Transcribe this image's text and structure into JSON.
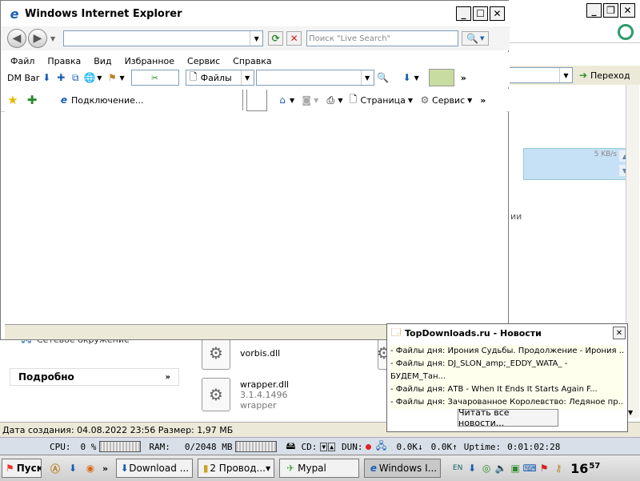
{
  "bg_window": {
    "addr_go_label": "Переход",
    "speed_text": "5 KB/s",
    "partial_text": "ии",
    "network_text": "Сетевое окружение",
    "details_label": "Подробно",
    "files": [
      {
        "name": "vorbis.dll",
        "version": "",
        "desc": ""
      },
      {
        "name": "wrapper.dll",
        "version": "3.1.4.1496",
        "desc": "wrapper"
      }
    ],
    "status_text": "Дата создания: 04.08.2022 23:56 Размер: 1,97 МБ"
  },
  "ie": {
    "title": "Windows Internet Explorer",
    "address_value": "",
    "search_placeholder": "Поиск \"Live Search\"",
    "menu": [
      "Файл",
      "Правка",
      "Вид",
      "Избранное",
      "Сервис",
      "Справка"
    ],
    "dmbar_label": "DM Bar",
    "files_combo": "Файлы",
    "fav_tab": "Подключение...",
    "page_label": "Страница",
    "service_label": "Сервис"
  },
  "popup": {
    "title": "TopDownloads.ru - Новости",
    "items": [
      "- Файлы дня: Ирония Судьбы. Продолжение - Ирония ...",
      "- Файлы дня: DJ_SLON_amp;_EDDY_WATA_ - БУДЕМ_Тан...",
      "- Файлы дня: АТВ - When It Ends It Starts Again F...",
      "- Файлы дня: Зачарованное Королевство: Ледяное пр..."
    ],
    "button": "Читать все новости..."
  },
  "meter": {
    "cpu_label": "CPU:",
    "cpu_value": "0 %",
    "ram_label": "RAM:",
    "ram_value": "0/2048 MB",
    "cd_label": "CD:",
    "dun_label": "DUN:",
    "down_value": "0.0K",
    "up_value": "0.0K",
    "uptime_label": "Uptime:",
    "uptime_value": "0:01:02:28"
  },
  "taskbar": {
    "start": "Пуск",
    "tasks": [
      "Download ...",
      "2 Провод...",
      "Mypal",
      "Windows I..."
    ],
    "clock_hour": "16",
    "clock_min": "57"
  },
  "colors": {
    "ie_blue": "#1a5fb4",
    "popup_body": "#ffffee",
    "taskbar": "#d9d9d9"
  }
}
